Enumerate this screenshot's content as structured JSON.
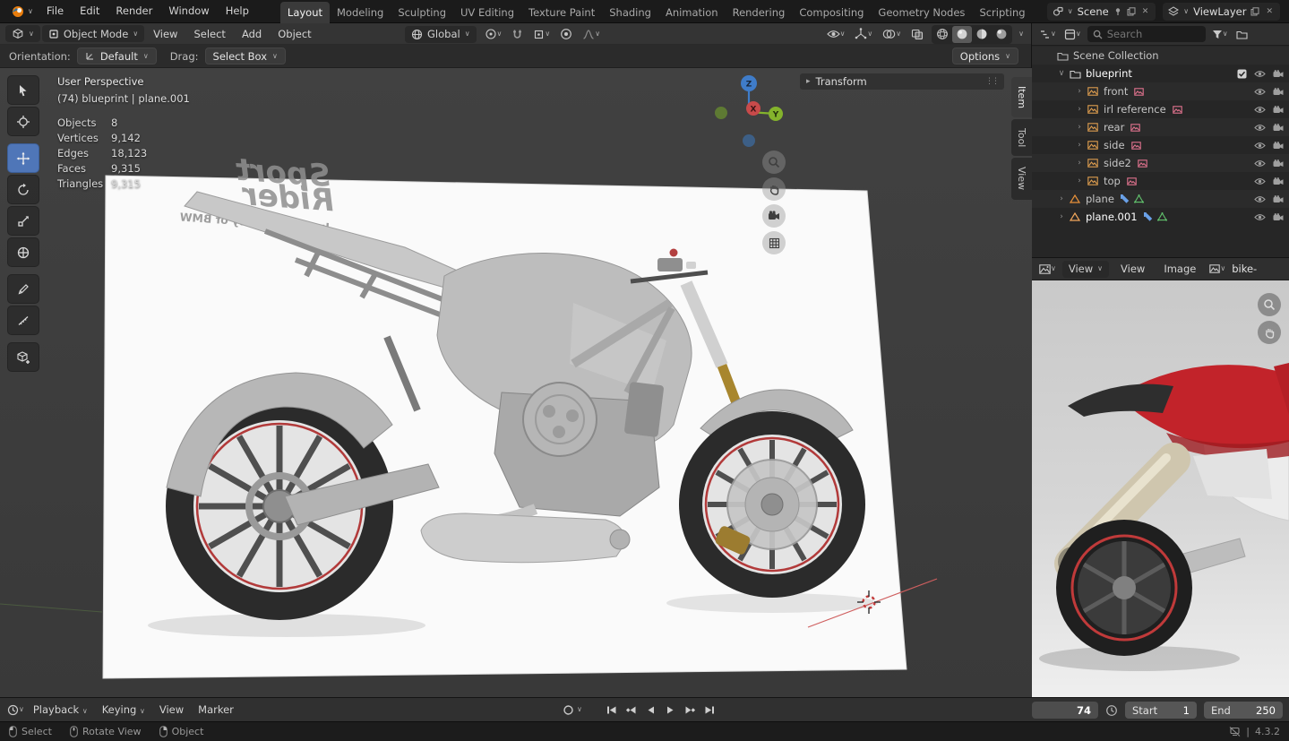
{
  "icons": {
    "chevron": "∨",
    "disclosure_open": "∨",
    "disclosure_closed": "›",
    "panel_arrow": "▸",
    "drag_dots": "⋮⋮",
    "close": "✕"
  },
  "topbar": {
    "menus": [
      "File",
      "Edit",
      "Render",
      "Window",
      "Help"
    ],
    "workspaces": [
      "Layout",
      "Modeling",
      "Sculpting",
      "UV Editing",
      "Texture Paint",
      "Shading",
      "Animation",
      "Rendering",
      "Compositing",
      "Geometry Nodes",
      "Scripting"
    ],
    "scene": "Scene",
    "viewlayer": "ViewLayer"
  },
  "viewport": {
    "header": {
      "mode": "Object Mode",
      "menus": [
        "View",
        "Select",
        "Add",
        "Object"
      ],
      "orientation": "Global"
    },
    "tool_settings": {
      "orientation_label": "Orientation:",
      "orientation_value": "Default",
      "drag_label": "Drag:",
      "drag_value": "Select Box",
      "options": "Options"
    },
    "overlay": {
      "view_name": "User Perspective",
      "context": "(74) blueprint | plane.001",
      "stats": [
        {
          "label": "Objects",
          "value": "8"
        },
        {
          "label": "Vertices",
          "value": "9,142"
        },
        {
          "label": "Edges",
          "value": "18,123"
        },
        {
          "label": "Faces",
          "value": "9,315"
        },
        {
          "label": "Triangles",
          "value": "9,315"
        }
      ]
    },
    "gizmo": {
      "x": "X",
      "y": "Y",
      "z": "Z"
    },
    "transform_panel_label": "Transform",
    "sidebar_tabs": [
      "Item",
      "Tool",
      "View"
    ],
    "blueprint": {
      "title_line1": "Sport",
      "title_line2": "Rider",
      "caption": "Image courtesy of BMW"
    }
  },
  "outliner": {
    "search_placeholder": "Search",
    "items": [
      {
        "name": "Scene Collection"
      },
      {
        "name": "blueprint"
      },
      {
        "name": "front"
      },
      {
        "name": "irl reference"
      },
      {
        "name": "rear"
      },
      {
        "name": "side"
      },
      {
        "name": "side2"
      },
      {
        "name": "top"
      },
      {
        "name": "plane"
      },
      {
        "name": "plane.001"
      }
    ]
  },
  "image_editor": {
    "mode": "View",
    "menus": [
      "View",
      "Image"
    ],
    "image_name": "bike-"
  },
  "timeline": {
    "menus": [
      "Playback",
      "Keying",
      "View",
      "Marker"
    ],
    "current_frame": "74",
    "start_label": "Start",
    "start_value": "1",
    "end_label": "End",
    "end_value": "250"
  },
  "statusbar": {
    "select": "Select",
    "rotate_view": "Rotate View",
    "object": "Object",
    "version": "4.3.2"
  },
  "colors": {
    "accent": "#4f76b8",
    "axis_x": "#c84a4a",
    "axis_y": "#84b32c",
    "axis_z": "#3f7cc9"
  }
}
